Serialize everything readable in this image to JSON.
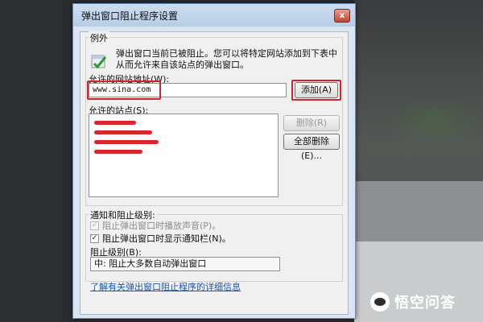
{
  "dialog": {
    "title": "弹出窗口阻止程序设置",
    "close_glyph": "x"
  },
  "exceptions": {
    "group_label": "例外",
    "info_text": "弹出窗口当前已被阻止。您可以将特定网站添加到下表中从而允许来自该站点的弹出窗口。",
    "address_label": "允许的网站地址(W):",
    "address_value": "www.sina.com",
    "add_button": "添加(A)",
    "allowed_sites_label": "允许的站点(S):",
    "allowed_sites_count": 4,
    "remove_button": "删除(R)",
    "remove_all_button": "全部删除(E)..."
  },
  "notifications": {
    "group_label": "通知和阻止级别:",
    "play_sound_label": "阻止弹出窗口时播放声音(P)。",
    "play_sound_checked": true,
    "show_bar_label": "阻止弹出窗口时显示通知栏(N)。",
    "show_bar_checked": true,
    "blocking_level_label": "阻止级别(B):",
    "blocking_level_value": "中: 阻止大多数自动弹出窗口"
  },
  "footer": {
    "learn_more_link": "了解有关弹出窗口阻止程序的详细信息"
  },
  "watermark": {
    "text": "悟空问答"
  },
  "colors": {
    "highlight": "#d3242a",
    "redaction": "#d8262c",
    "link": "#1a55b0"
  }
}
